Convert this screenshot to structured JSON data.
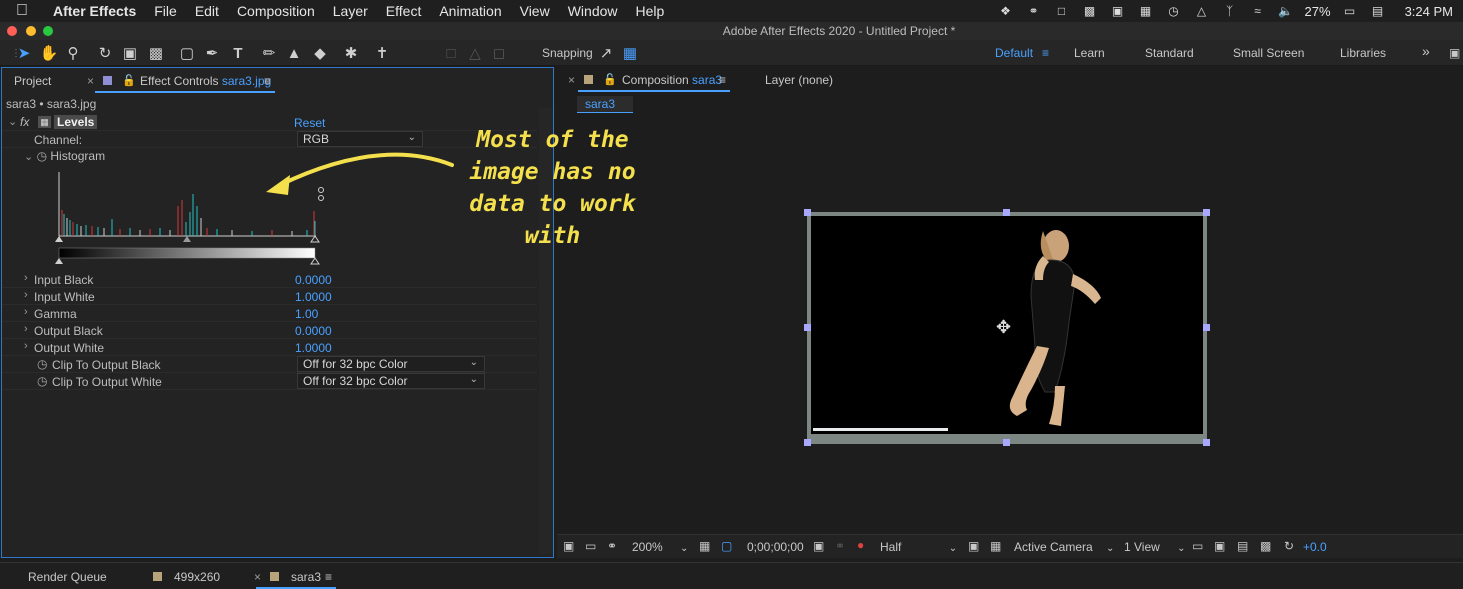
{
  "menubar": {
    "app_name": "After Effects",
    "items": [
      "File",
      "Edit",
      "Composition",
      "Layer",
      "Effect",
      "Animation",
      "View",
      "Window",
      "Help"
    ],
    "battery": "27%",
    "time": "3:24 PM"
  },
  "window": {
    "title": "Adobe After Effects 2020 - Untitled Project *"
  },
  "toolbar": {
    "snapping_label": "Snapping",
    "workspaces": [
      "Default",
      "Learn",
      "Standard",
      "Small Screen",
      "Libraries"
    ],
    "active_workspace": "Default"
  },
  "left_panel": {
    "tab_project": "Project",
    "tab_effect_controls": "Effect Controls",
    "tab_effect_controls_target": "sara3.jpg",
    "breadcrumb": "sara3 • sara3.jpg",
    "effect_name": "Levels",
    "reset_label": "Reset",
    "channel_label": "Channel:",
    "channel_value": "RGB",
    "histogram_label": "Histogram",
    "properties": [
      {
        "label": "Input Black",
        "value": "0.0000"
      },
      {
        "label": "Input White",
        "value": "1.0000"
      },
      {
        "label": "Gamma",
        "value": "1.00"
      },
      {
        "label": "Output Black",
        "value": "0.0000"
      },
      {
        "label": "Output White",
        "value": "1.0000"
      }
    ],
    "clip_black_label": "Clip To Output Black",
    "clip_black_value": "Off for 32 bpc Color",
    "clip_white_label": "Clip To Output White",
    "clip_white_value": "Off for 32 bpc Color"
  },
  "right_panel": {
    "tab_composition": "Composition",
    "tab_composition_name": "sara3",
    "tab_layer": "Layer (none)",
    "comp_subtab": "sara3",
    "viewer_bar": {
      "zoom": "200%",
      "timecode": "0;00;00;00",
      "resolution": "Half",
      "camera": "Active Camera",
      "views": "1 View",
      "exposure": "+0.0"
    }
  },
  "annotation": {
    "lines": [
      "Most of the",
      "image has no",
      "data to work",
      "with"
    ]
  },
  "bottom_bar": {
    "render_queue": "Render Queue",
    "comp1": "499x260",
    "comp2": "sara3"
  },
  "colors": {
    "accent": "#4aa0ff",
    "annotation": "#f4e04d",
    "panel_border": "#2f78c9"
  }
}
